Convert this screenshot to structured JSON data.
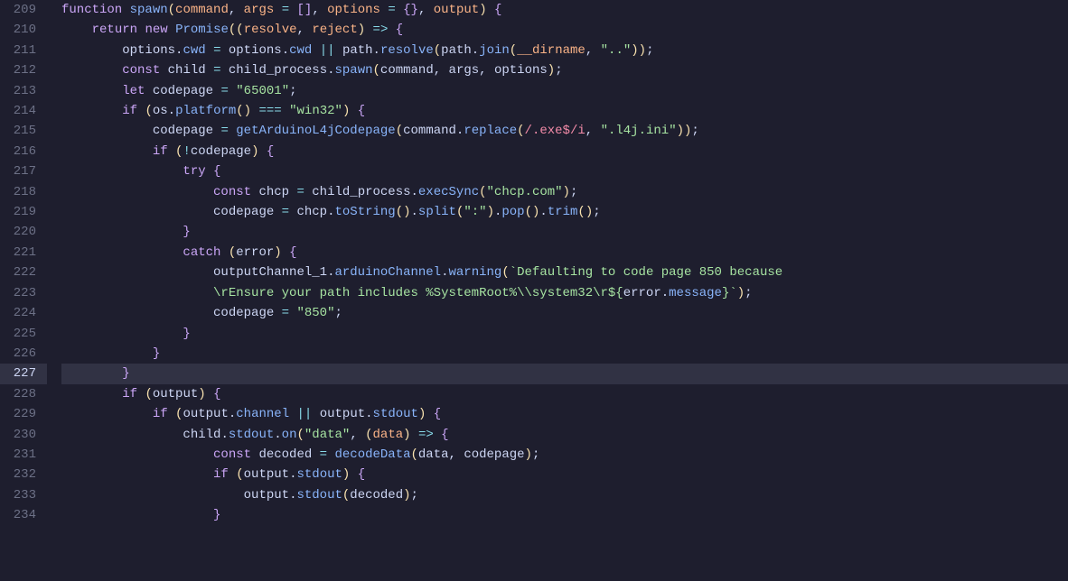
{
  "editor": {
    "lines": [
      {
        "number": 209,
        "active": false
      },
      {
        "number": 210,
        "active": false
      },
      {
        "number": 211,
        "active": false
      },
      {
        "number": 212,
        "active": false
      },
      {
        "number": 213,
        "active": false
      },
      {
        "number": 214,
        "active": false
      },
      {
        "number": 215,
        "active": false
      },
      {
        "number": 216,
        "active": false
      },
      {
        "number": 217,
        "active": false
      },
      {
        "number": 218,
        "active": false
      },
      {
        "number": 219,
        "active": false
      },
      {
        "number": 220,
        "active": false
      },
      {
        "number": 221,
        "active": false
      },
      {
        "number": 222,
        "active": false
      },
      {
        "number": 223,
        "active": false
      },
      {
        "number": 224,
        "active": false
      },
      {
        "number": 225,
        "active": false
      },
      {
        "number": 226,
        "active": false
      },
      {
        "number": 227,
        "active": true
      },
      {
        "number": 228,
        "active": false
      },
      {
        "number": 229,
        "active": false
      },
      {
        "number": 230,
        "active": false
      },
      {
        "number": 231,
        "active": false
      },
      {
        "number": 232,
        "active": false
      },
      {
        "number": 233,
        "active": false
      },
      {
        "number": 234,
        "active": false
      }
    ]
  }
}
